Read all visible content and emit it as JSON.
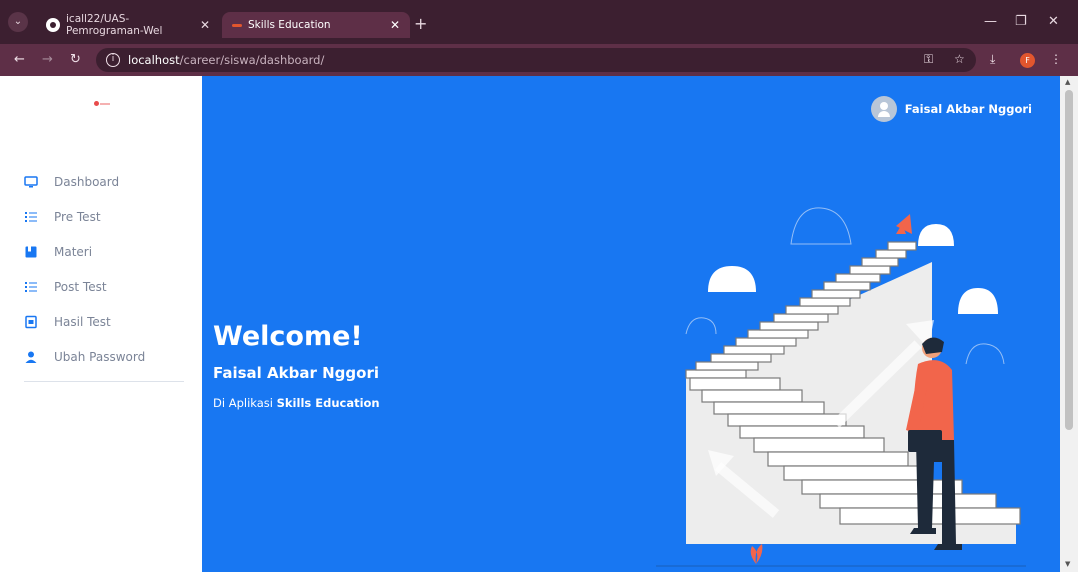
{
  "browser": {
    "tabs": [
      {
        "title": "icall22/UAS-Pemrograman-Wel"
      },
      {
        "title": "Skills Education"
      }
    ],
    "url_host": "localhost",
    "url_path": "/career/siswa/dashboard/",
    "profile_initial": "F"
  },
  "sidebar": {
    "items": [
      {
        "label": "Dashboard",
        "icon": "monitor-icon"
      },
      {
        "label": "Pre Test",
        "icon": "list-icon"
      },
      {
        "label": "Materi",
        "icon": "book-icon"
      },
      {
        "label": "Post Test",
        "icon": "list-icon"
      },
      {
        "label": "Hasil Test",
        "icon": "report-icon"
      },
      {
        "label": "Ubah Password",
        "icon": "user-icon"
      }
    ]
  },
  "header": {
    "user_name": "Faisal Akbar Nggori"
  },
  "hero": {
    "title": "Welcome!",
    "name": "Faisal Akbar Nggori",
    "subtitle_prefix": "Di Aplikasi",
    "app_name": "Skills Education"
  },
  "colors": {
    "accent": "#1877f2",
    "chrome": "#3c1f30",
    "sidebar_text": "#7b8497"
  }
}
